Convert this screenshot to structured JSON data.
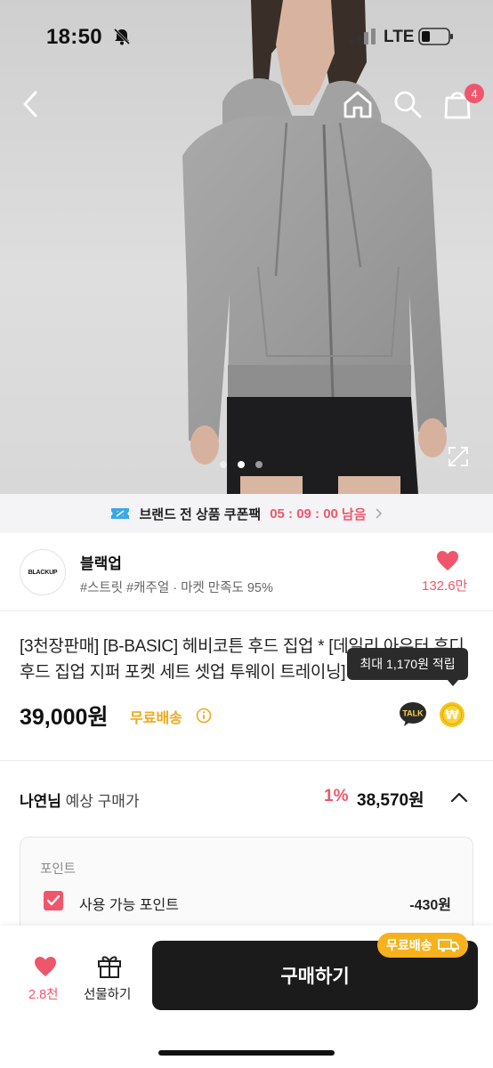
{
  "status_bar": {
    "time": "18:50",
    "network": "LTE"
  },
  "header": {
    "cart_count": "4"
  },
  "gallery": {
    "total": 3,
    "active_index": 1
  },
  "coupon_banner": {
    "text": "브랜드 전 상품 쿠폰팩",
    "timer": "05 : 09 : 00",
    "suffix": "남음"
  },
  "brand": {
    "logo_text": "BLACKUP",
    "name": "블랙업",
    "tags": "#스트릿 #캐주얼 · 마켓 만족도 95%",
    "likes": "132.6만"
  },
  "product": {
    "title": "[3천장판매] [B-BASIC] 헤비코튼 후드 집업 * [데일리 아우터 후디 후드 집업 지퍼 포켓 세트 셋업 투웨이 트레이닝]",
    "price": "39,000원",
    "free_shipping": "무료배송",
    "tooltip": "최대 1,170원 적립",
    "talk_label": "TALK",
    "coin_symbol": "₩"
  },
  "expected": {
    "user_name": "나연님",
    "label": "예상 구매가",
    "rate": "1%",
    "price": "38,570원"
  },
  "points": {
    "heading": "포인트",
    "label": "사용 가능 포인트",
    "value": "-430원"
  },
  "bottom_bar": {
    "wish_count": "2.8천",
    "gift_label": "선물하기",
    "buy_label": "구매하기",
    "ship_badge": "무료배송"
  },
  "colors": {
    "accent": "#f0566b",
    "badge_yellow": "#f6b21c",
    "buy_button": "#1b1b1b"
  }
}
